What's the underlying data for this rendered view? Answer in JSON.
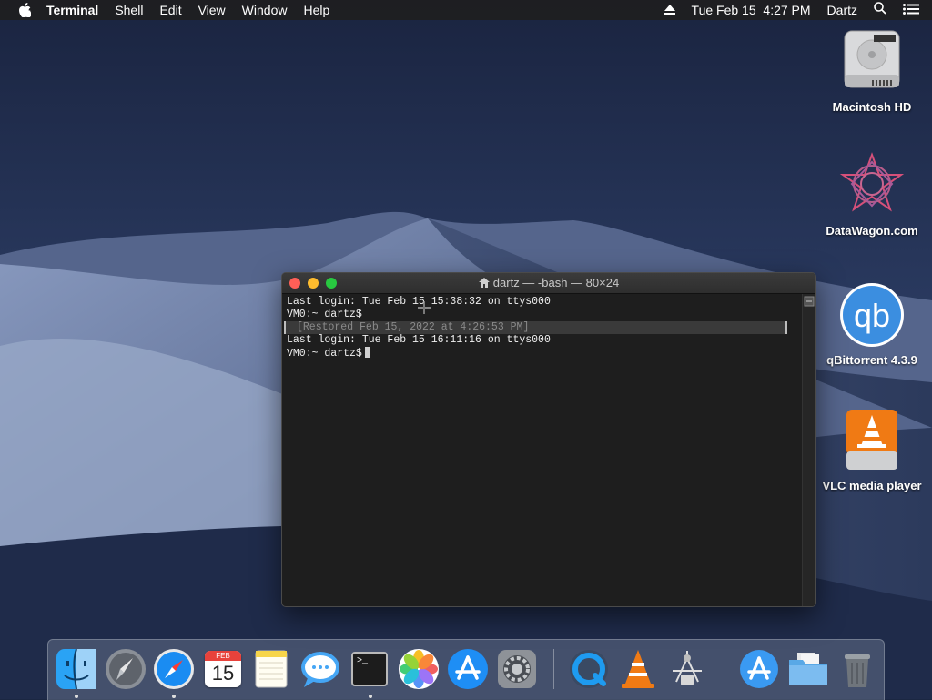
{
  "menubar": {
    "apple": "apple-icon",
    "app_name": "Terminal",
    "menus": [
      "Shell",
      "Edit",
      "View",
      "Window",
      "Help"
    ],
    "datetime": "Tue Feb 15  4:27 PM",
    "user": "Dartz"
  },
  "desktop": {
    "icons": [
      {
        "label": "Macintosh HD",
        "icon": "hard-drive-icon"
      },
      {
        "label": "DataWagon.com",
        "icon": "datawagon-icon"
      },
      {
        "label": "qBittorrent 4.3.9",
        "icon": "qbittorrent-icon"
      },
      {
        "label": "VLC media player",
        "icon": "vlc-disk-icon"
      }
    ]
  },
  "terminal": {
    "title": "dartz — -bash — 80×24",
    "lines": [
      "Last login: Tue Feb 15 15:38:32 on ttys000",
      "VM0:~ dartz$",
      "[Restored Feb 15, 2022 at 4:26:53 PM]",
      "Last login: Tue Feb 15 16:11:16 on ttys000",
      "VM0:~ dartz$"
    ]
  },
  "dock": {
    "calendar_month": "FEB",
    "calendar_day": "15",
    "terminal_prompt": ">_",
    "qb_label": "qb",
    "items": [
      "Finder",
      "Launchpad",
      "Safari",
      "Calendar",
      "Notes",
      "Messages",
      "Terminal",
      "Photos",
      "App Store",
      "System Preferences",
      "QuickTime Player",
      "VLC",
      "Directory Utility",
      "Applications",
      "Downloads",
      "Trash"
    ]
  },
  "colors": {
    "close": "#ff5f57",
    "minimize": "#febc2e",
    "zoom": "#28c840"
  }
}
